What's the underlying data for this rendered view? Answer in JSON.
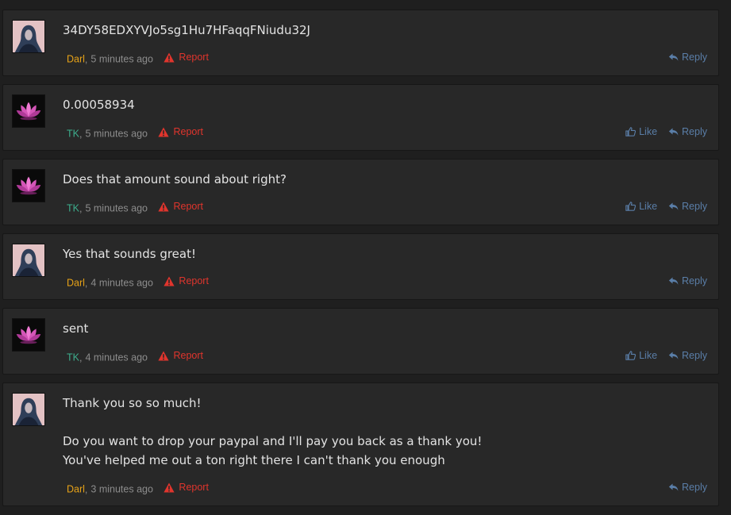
{
  "colors": {
    "page_bg": "#1f1f1f",
    "post_bg": "#282828",
    "author_darl": "#e8a317",
    "author_tk": "#3dae8d",
    "report": "#e0352d",
    "action": "#5a7ea8"
  },
  "labels": {
    "report": "Report",
    "like": "Like",
    "reply": "Reply"
  },
  "posts": [
    {
      "author": "Darl",
      "time": "5 minutes ago",
      "lines": [
        "34DY58EDXYVJo5sg1Hu7HFaqqFNiudu32J"
      ]
    },
    {
      "author": "TK",
      "time": "5 minutes ago",
      "lines": [
        "0.00058934"
      ]
    },
    {
      "author": "TK",
      "time": "5 minutes ago",
      "lines": [
        "Does that amount sound about right?"
      ]
    },
    {
      "author": "Darl",
      "time": "4 minutes ago",
      "lines": [
        "Yes that sounds great!"
      ]
    },
    {
      "author": "TK",
      "time": "4 minutes ago",
      "lines": [
        "sent"
      ]
    },
    {
      "author": "Darl",
      "time": "3 minutes ago",
      "lines": [
        "Thank you so so much!",
        "",
        "Do you want to drop your paypal and I'll pay you back as a thank you!",
        "You've helped me out a ton right there I can't thank you enough"
      ]
    }
  ]
}
